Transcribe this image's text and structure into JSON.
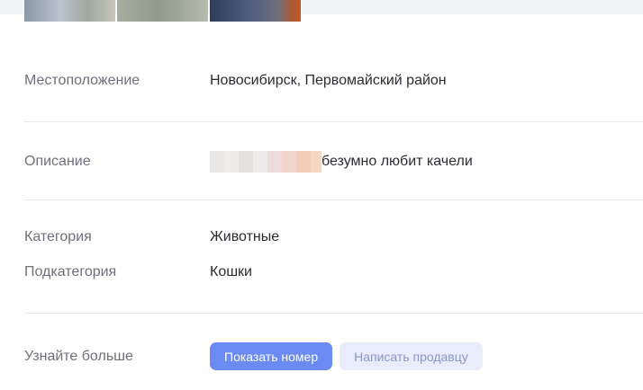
{
  "details": {
    "location": {
      "label": "Местоположение",
      "value": "Новосибирск, Первомайский район"
    },
    "description": {
      "label": "Описание",
      "value": "безумно любит качели"
    },
    "category": {
      "label": "Категория",
      "value": "Животные"
    },
    "subcategory": {
      "label": "Подкатегория",
      "value": "Кошки"
    },
    "learn_more": {
      "label": "Узнайте больше"
    }
  },
  "actions": {
    "show_number": "Показать номер",
    "write_seller": "Написать продавцу"
  },
  "colors": {
    "primary_button": "#6b8af2",
    "secondary_button": "#e9edfb"
  }
}
